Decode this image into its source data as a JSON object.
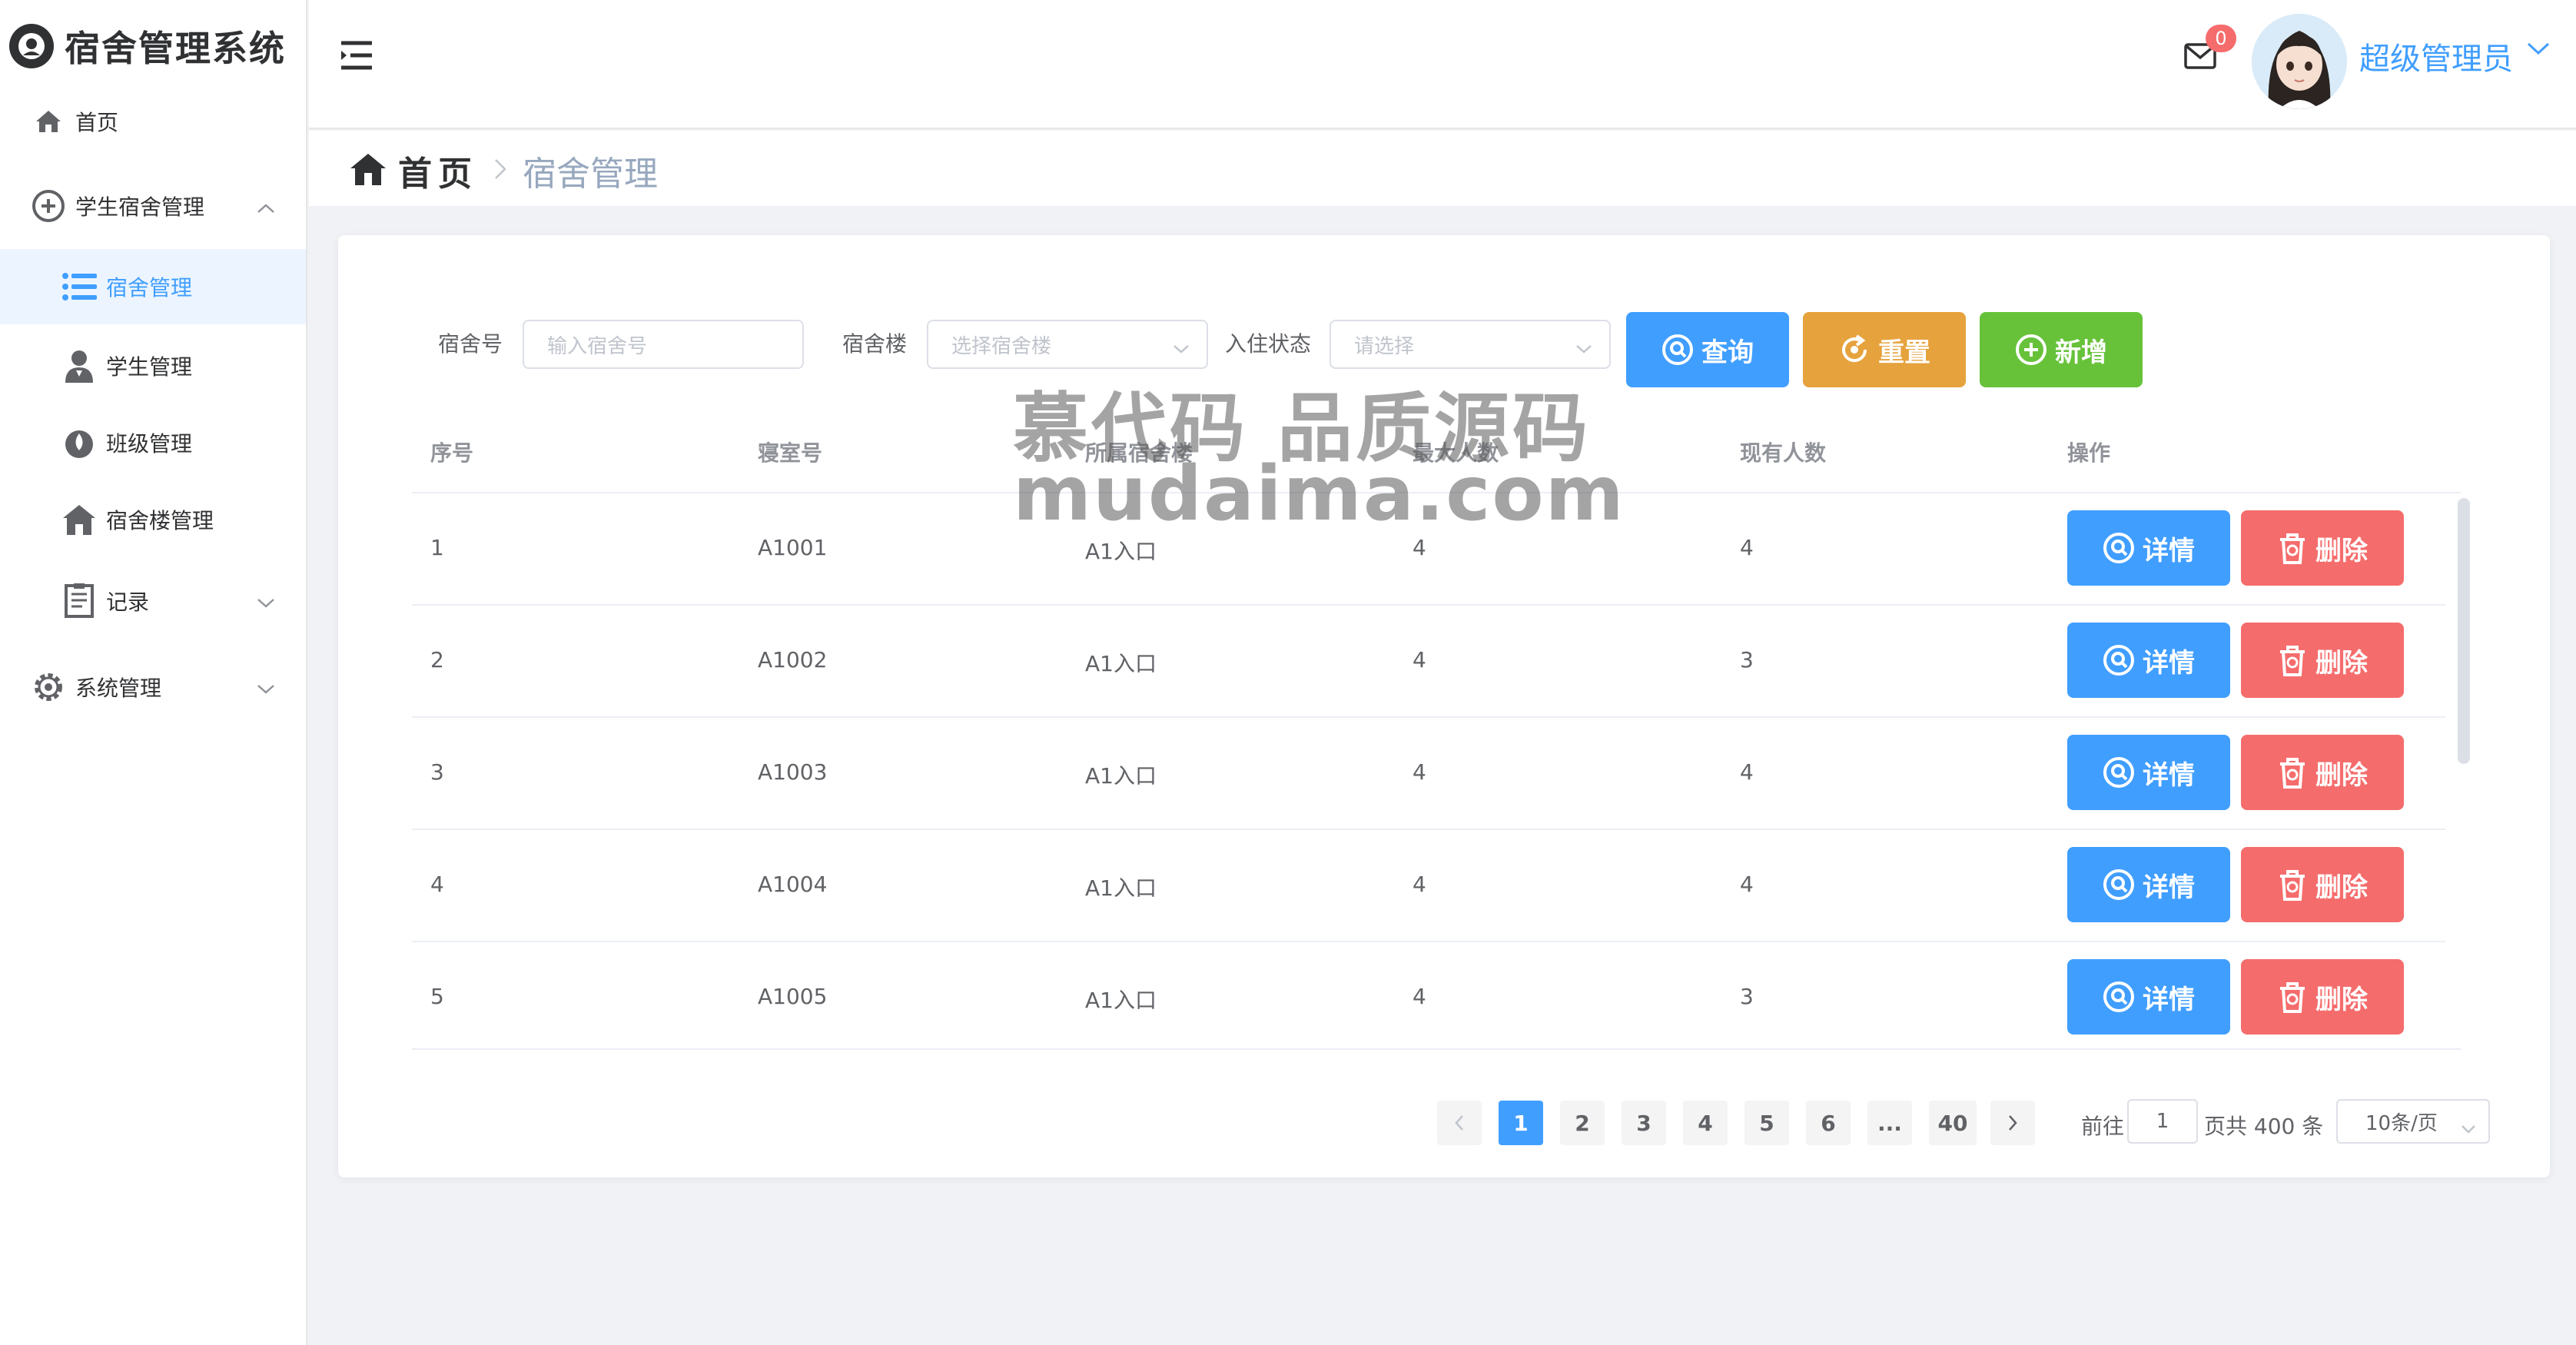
{
  "app": {
    "title": "宿舍管理系统"
  },
  "sidebar": {
    "items": [
      {
        "label": "首页",
        "icon": "home-icon"
      },
      {
        "label": "学生宿舍管理",
        "icon": "plus-circle-icon",
        "expanded": true
      },
      {
        "label": "宿舍管理",
        "icon": "list-icon",
        "active": true
      },
      {
        "label": "学生管理",
        "icon": "user-icon"
      },
      {
        "label": "班级管理",
        "icon": "drop-icon"
      },
      {
        "label": "宿舍楼管理",
        "icon": "building-icon"
      },
      {
        "label": "记录",
        "icon": "document-icon"
      },
      {
        "label": "系统管理",
        "icon": "gear-icon"
      }
    ]
  },
  "header": {
    "message_count": "0",
    "username": "超级管理员"
  },
  "breadcrumb": {
    "home": "首页",
    "current": "宿舍管理"
  },
  "filters": {
    "dorm_no_label": "宿舍号",
    "dorm_no_placeholder": "输入宿舍号",
    "building_label": "宿舍楼",
    "building_placeholder": "选择宿舍楼",
    "status_label": "入住状态",
    "status_placeholder": "请选择"
  },
  "actions": {
    "query": "查询",
    "reset": "重置",
    "add": "新增"
  },
  "table": {
    "columns": [
      "序号",
      "寝室号",
      "所属宿舍楼",
      "最大人数",
      "现有人数",
      "操作"
    ],
    "rows": [
      {
        "index": "1",
        "room": "A1001",
        "building": "A1入口",
        "max": "4",
        "current": "4"
      },
      {
        "index": "2",
        "room": "A1002",
        "building": "A1入口",
        "max": "4",
        "current": "3"
      },
      {
        "index": "3",
        "room": "A1003",
        "building": "A1入口",
        "max": "4",
        "current": "4"
      },
      {
        "index": "4",
        "room": "A1004",
        "building": "A1入口",
        "max": "4",
        "current": "4"
      },
      {
        "index": "5",
        "room": "A1005",
        "building": "A1入口",
        "max": "4",
        "current": "3"
      }
    ],
    "detail_label": "详情",
    "delete_label": "删除"
  },
  "pagination": {
    "pages": [
      "1",
      "2",
      "3",
      "4",
      "5",
      "6",
      "...",
      "40"
    ],
    "current": "1",
    "goto_label": "前往",
    "goto_value": "1",
    "total_label": "页共 400 条",
    "page_size": "10条/页"
  },
  "watermark": {
    "line1": "慕代码 品质源码",
    "line2": "mudaima.com"
  },
  "colors": {
    "primary": "#409eff",
    "warning": "#e6a23c",
    "success": "#67c23a",
    "danger": "#f56c6c"
  }
}
